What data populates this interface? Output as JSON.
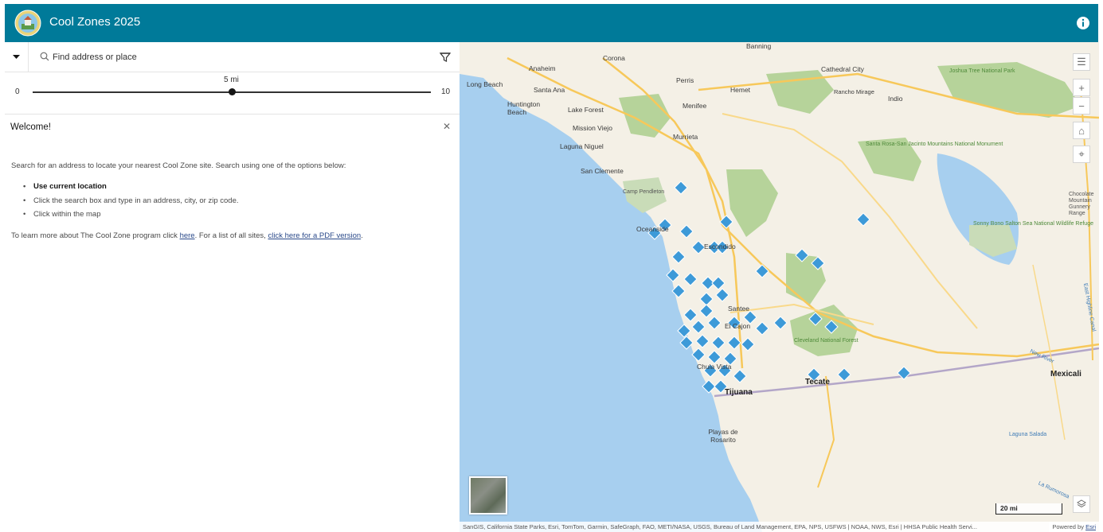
{
  "header": {
    "title": "Cool Zones 2025",
    "info_icon": "info-icon",
    "logo_icon": "seal-logo"
  },
  "search": {
    "placeholder": "Find address or place",
    "filter_icon": "filter-icon"
  },
  "slider": {
    "min_label": "0",
    "max_label": "10",
    "value_label": "5 mi",
    "value": 5,
    "min": 0,
    "max": 10
  },
  "welcome": {
    "title": "Welcome!",
    "intro": "Search for an address to locate your nearest Cool Zone site. Search using one of the options below:",
    "options": [
      "Use current location",
      "Click the search box and type in an address, city, or zip code.",
      "Click within the map"
    ],
    "more_prefix": "To learn more about The Cool Zone program click ",
    "more_link1": "here",
    "more_middle": ". For a list of all sites, ",
    "more_link2": "click here for a PDF version",
    "more_suffix": "."
  },
  "map": {
    "labels": {
      "banning": "Banning",
      "corona": "Corona",
      "anaheim": "Anaheim",
      "long_beach": "Long Beach",
      "santa_ana": "Santa Ana",
      "perris": "Perris",
      "hemet": "Hemet",
      "cathedral_city": "Cathedral City",
      "rancho_mirage": "Rancho Mirage",
      "indio": "Indio",
      "joshua_tree": "Joshua Tree National Park",
      "huntington_beach": "Huntington Beach",
      "lake_forest": "Lake Forest",
      "menifee": "Menifee",
      "mission_viejo": "Mission Viejo",
      "laguna_niguel": "Laguna Niguel",
      "murrieta": "Murrieta",
      "san_clemente": "San Clemente",
      "santa_rosa": "Santa Rosa-San Jacinto Mountains National Monument",
      "camp_pendleton": "Camp Pendleton",
      "chocolate": "Chocolate Mountain Gunnery Range",
      "oceanside": "Oceanside",
      "escondido": "Escondido",
      "sonny_bono": "Sonny Bono Salton Sea National Wildlife Refuge",
      "santee": "Santee",
      "el_cajon": "El Cajon",
      "cleveland": "Cleveland National Forest",
      "chula_vista": "Chula Vista",
      "tijuana": "Tijuana",
      "tecate": "Tecate",
      "mexicali": "Mexicali",
      "playas": "Playas de Rosarito",
      "laguna_salada": "Laguna Salada",
      "la_rumorosa": "La Rumorosa",
      "east_highline": "East Highline Canal",
      "new_river": "New River"
    },
    "tool_icons": [
      "legend-icon",
      "zoom-in-icon",
      "zoom-out-icon",
      "home-icon",
      "locate-icon"
    ],
    "tool_glyphs": [
      "☰",
      "+",
      "−",
      "⌂",
      "⌖"
    ],
    "scale_label": "20 mi",
    "attribution": "SanGIS, California State Parks, Esri, TomTom, Garmin, SafeGraph, FAO, METI/NASA, USGS, Bureau of Land Management, EPA, NPS, USFWS | NOAA, NWS, Esri | HHSA Public Health Servi...",
    "powered_prefix": "Powered by ",
    "powered_link": "Esri",
    "colors": {
      "water": "#a7cfef",
      "land": "#f4f0e6",
      "park": "#b6d39a",
      "highway": "#f7c85a",
      "marker": "#3d9ad8",
      "header": "#007a99"
    }
  }
}
